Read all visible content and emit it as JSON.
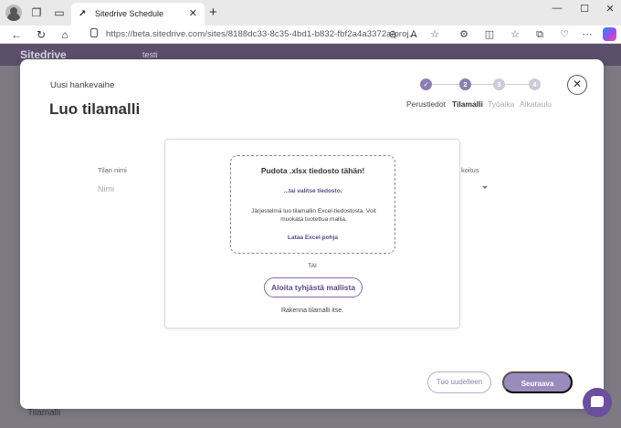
{
  "browser": {
    "tab_title": "Sitedrive Schedule",
    "tab_close": "✕",
    "new_tab": "+",
    "minimize": "—",
    "maximize": "☐",
    "close": "✕",
    "url": "https://beta.sitedrive.com/sites/8188dc33-8c35-4bd1-b832-fbf2a4a3372a/proj..."
  },
  "app": {
    "logo": "Sitedrive",
    "project": "testi",
    "background_title": "Tilamalli"
  },
  "modal": {
    "eyebrow": "Uusi hankevaihe",
    "title": "Luo tilamalli",
    "close_glyph": "✕",
    "steps": [
      {
        "number": "✓",
        "label": "Perustiedot",
        "state": "done"
      },
      {
        "number": "2",
        "label": "Tilamalli",
        "state": "active"
      },
      {
        "number": "3",
        "label": "Työaika",
        "state": "pending"
      },
      {
        "number": "4",
        "label": "Aikataulu",
        "state": "pending"
      }
    ],
    "form": {
      "space_name_label": "Tilan nimi",
      "space_name_placeholder": "Nimi",
      "usage_label": "koitus"
    },
    "panel": {
      "drop_title": "Pudota .xlsx tiedosto tähän!",
      "choose_file": "...tai valitse tiedosto.",
      "description": "Järjestelmä luo tilamallin Excel-tiedostosta. Voit muokata tuotettua mallia.",
      "download_template": "Lataa Excel pohja",
      "or": "TAI",
      "start_empty": "Aloita tyhjästä mallista",
      "build_yourself": "Rakenna tilamalli itse."
    },
    "footer": {
      "import": "Tuo uudelleen",
      "next": "Seuraava"
    }
  },
  "colors": {
    "accent": "#8c7fb0",
    "accent_dark": "#5b4a8a",
    "step_done": "#8c7fb0",
    "step_pending": "#cfcad8",
    "next_button": "#9a8bbd"
  }
}
